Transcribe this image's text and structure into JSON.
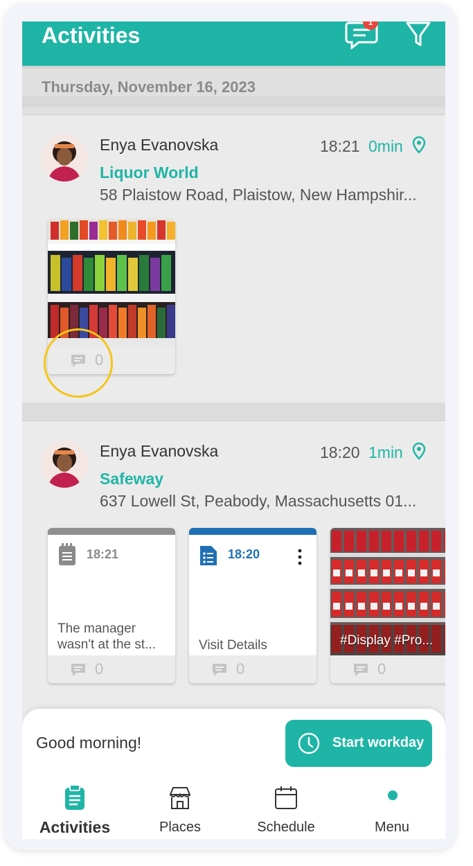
{
  "header": {
    "title": "Activities",
    "chat_badge_count": "1",
    "accent_color": "#1fb5a6"
  },
  "date_header": "Thursday, November 16, 2023",
  "activities": [
    {
      "user_name": "Enya Evanovska",
      "time": "18:21",
      "duration": "0min",
      "place": "Liquor World",
      "address": "58 Plaistow Road, Plaistow, New Hampshir...",
      "attachments": [
        {
          "type": "photo",
          "comment_count": "0"
        }
      ]
    },
    {
      "user_name": "Enya Evanovska",
      "time": "18:20",
      "duration": "1min",
      "place": "Safeway",
      "address": "637 Lowell St, Peabody, Massachusetts 01...",
      "attachments": [
        {
          "type": "note",
          "time": "18:21",
          "text": "The manager wasn't at the st...",
          "comment_count": "0"
        },
        {
          "type": "form",
          "time": "18:20",
          "text": "Visit Details",
          "comment_count": "0"
        },
        {
          "type": "photo",
          "tags": "#Display #Pro...",
          "comment_count": "0"
        }
      ]
    }
  ],
  "bottom_sheet": {
    "greeting": "Good morning!",
    "start_button": "Start workday"
  },
  "nav": [
    {
      "label": "Activities",
      "icon": "clipboard-icon",
      "active": true
    },
    {
      "label": "Places",
      "icon": "store-icon",
      "active": false
    },
    {
      "label": "Schedule",
      "icon": "calendar-icon",
      "active": false
    },
    {
      "label": "Menu",
      "icon": "dot-icon",
      "active": false
    }
  ]
}
